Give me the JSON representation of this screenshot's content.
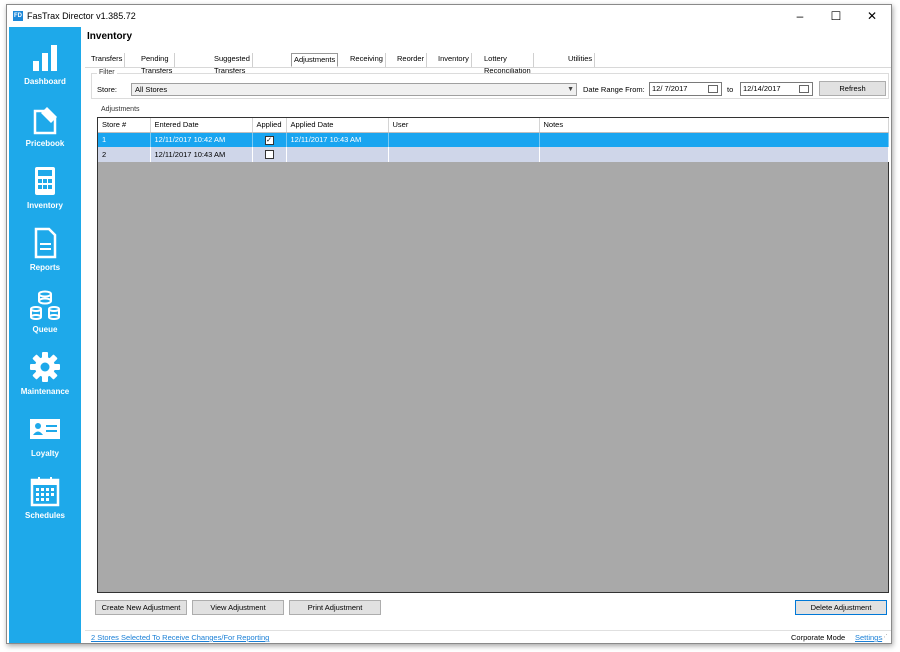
{
  "window": {
    "title": "FasTrax Director v1.385.72",
    "icon_text": "FD",
    "minimize": "–",
    "maximize": "☐",
    "close": "✕"
  },
  "sidebar": {
    "accent": "#1ea9ea",
    "items": [
      {
        "label": "Dashboard",
        "icon": "bar-chart-icon"
      },
      {
        "label": "Pricebook",
        "icon": "tag-edit-icon"
      },
      {
        "label": "Inventory",
        "icon": "calculator-icon"
      },
      {
        "label": "Reports",
        "icon": "document-icon"
      },
      {
        "label": "Queue",
        "icon": "database-sync-icon"
      },
      {
        "label": "Maintenance",
        "icon": "gear-icon"
      },
      {
        "label": "Loyalty",
        "icon": "id-card-icon"
      },
      {
        "label": "Schedules",
        "icon": "calendar-icon"
      }
    ]
  },
  "page": {
    "title": "Inventory"
  },
  "tabs": [
    {
      "label": "Transfers",
      "active": false
    },
    {
      "label": "Pending Transfers",
      "active": false
    },
    {
      "label": "Suggested Transfers",
      "active": false
    },
    {
      "label": "Adjustments",
      "active": true
    },
    {
      "label": "Receiving",
      "active": false
    },
    {
      "label": "Reorder",
      "active": false
    },
    {
      "label": "Inventory",
      "active": false
    },
    {
      "label": "Lottery Reconciliation",
      "active": false
    },
    {
      "label": "Utilities",
      "active": false
    }
  ],
  "filter": {
    "group_label": "Filter",
    "store_label": "Store:",
    "store_value": "All Stores",
    "date_range_label": "Date Range From:",
    "date_from": "12/ 7/2017",
    "to_label": "to",
    "date_to": "12/14/2017",
    "refresh_label": "Refresh"
  },
  "adjustments": {
    "group_label": "Adjustments",
    "columns": [
      "Store #",
      "Entered Date",
      "Applied",
      "Applied Date",
      "User",
      "Notes"
    ],
    "rows": [
      {
        "store": "1",
        "entered": "12/11/2017 10:42 AM",
        "applied": true,
        "applied_date": "12/11/2017 10:43 AM",
        "user": "",
        "notes": "",
        "selected": true
      },
      {
        "store": "2",
        "entered": "12/11/2017 10:43 AM",
        "applied": false,
        "applied_date": "",
        "user": "",
        "notes": "",
        "selected": false
      }
    ]
  },
  "actions": {
    "create": "Create New Adjustment",
    "view": "View Adjustment",
    "print": "Print Adjustment",
    "delete": "Delete Adjustment"
  },
  "status": {
    "stores_link": "2 Stores Selected To Receive Changes/For Reporting",
    "mode": "Corporate Mode",
    "settings": "Settings"
  }
}
